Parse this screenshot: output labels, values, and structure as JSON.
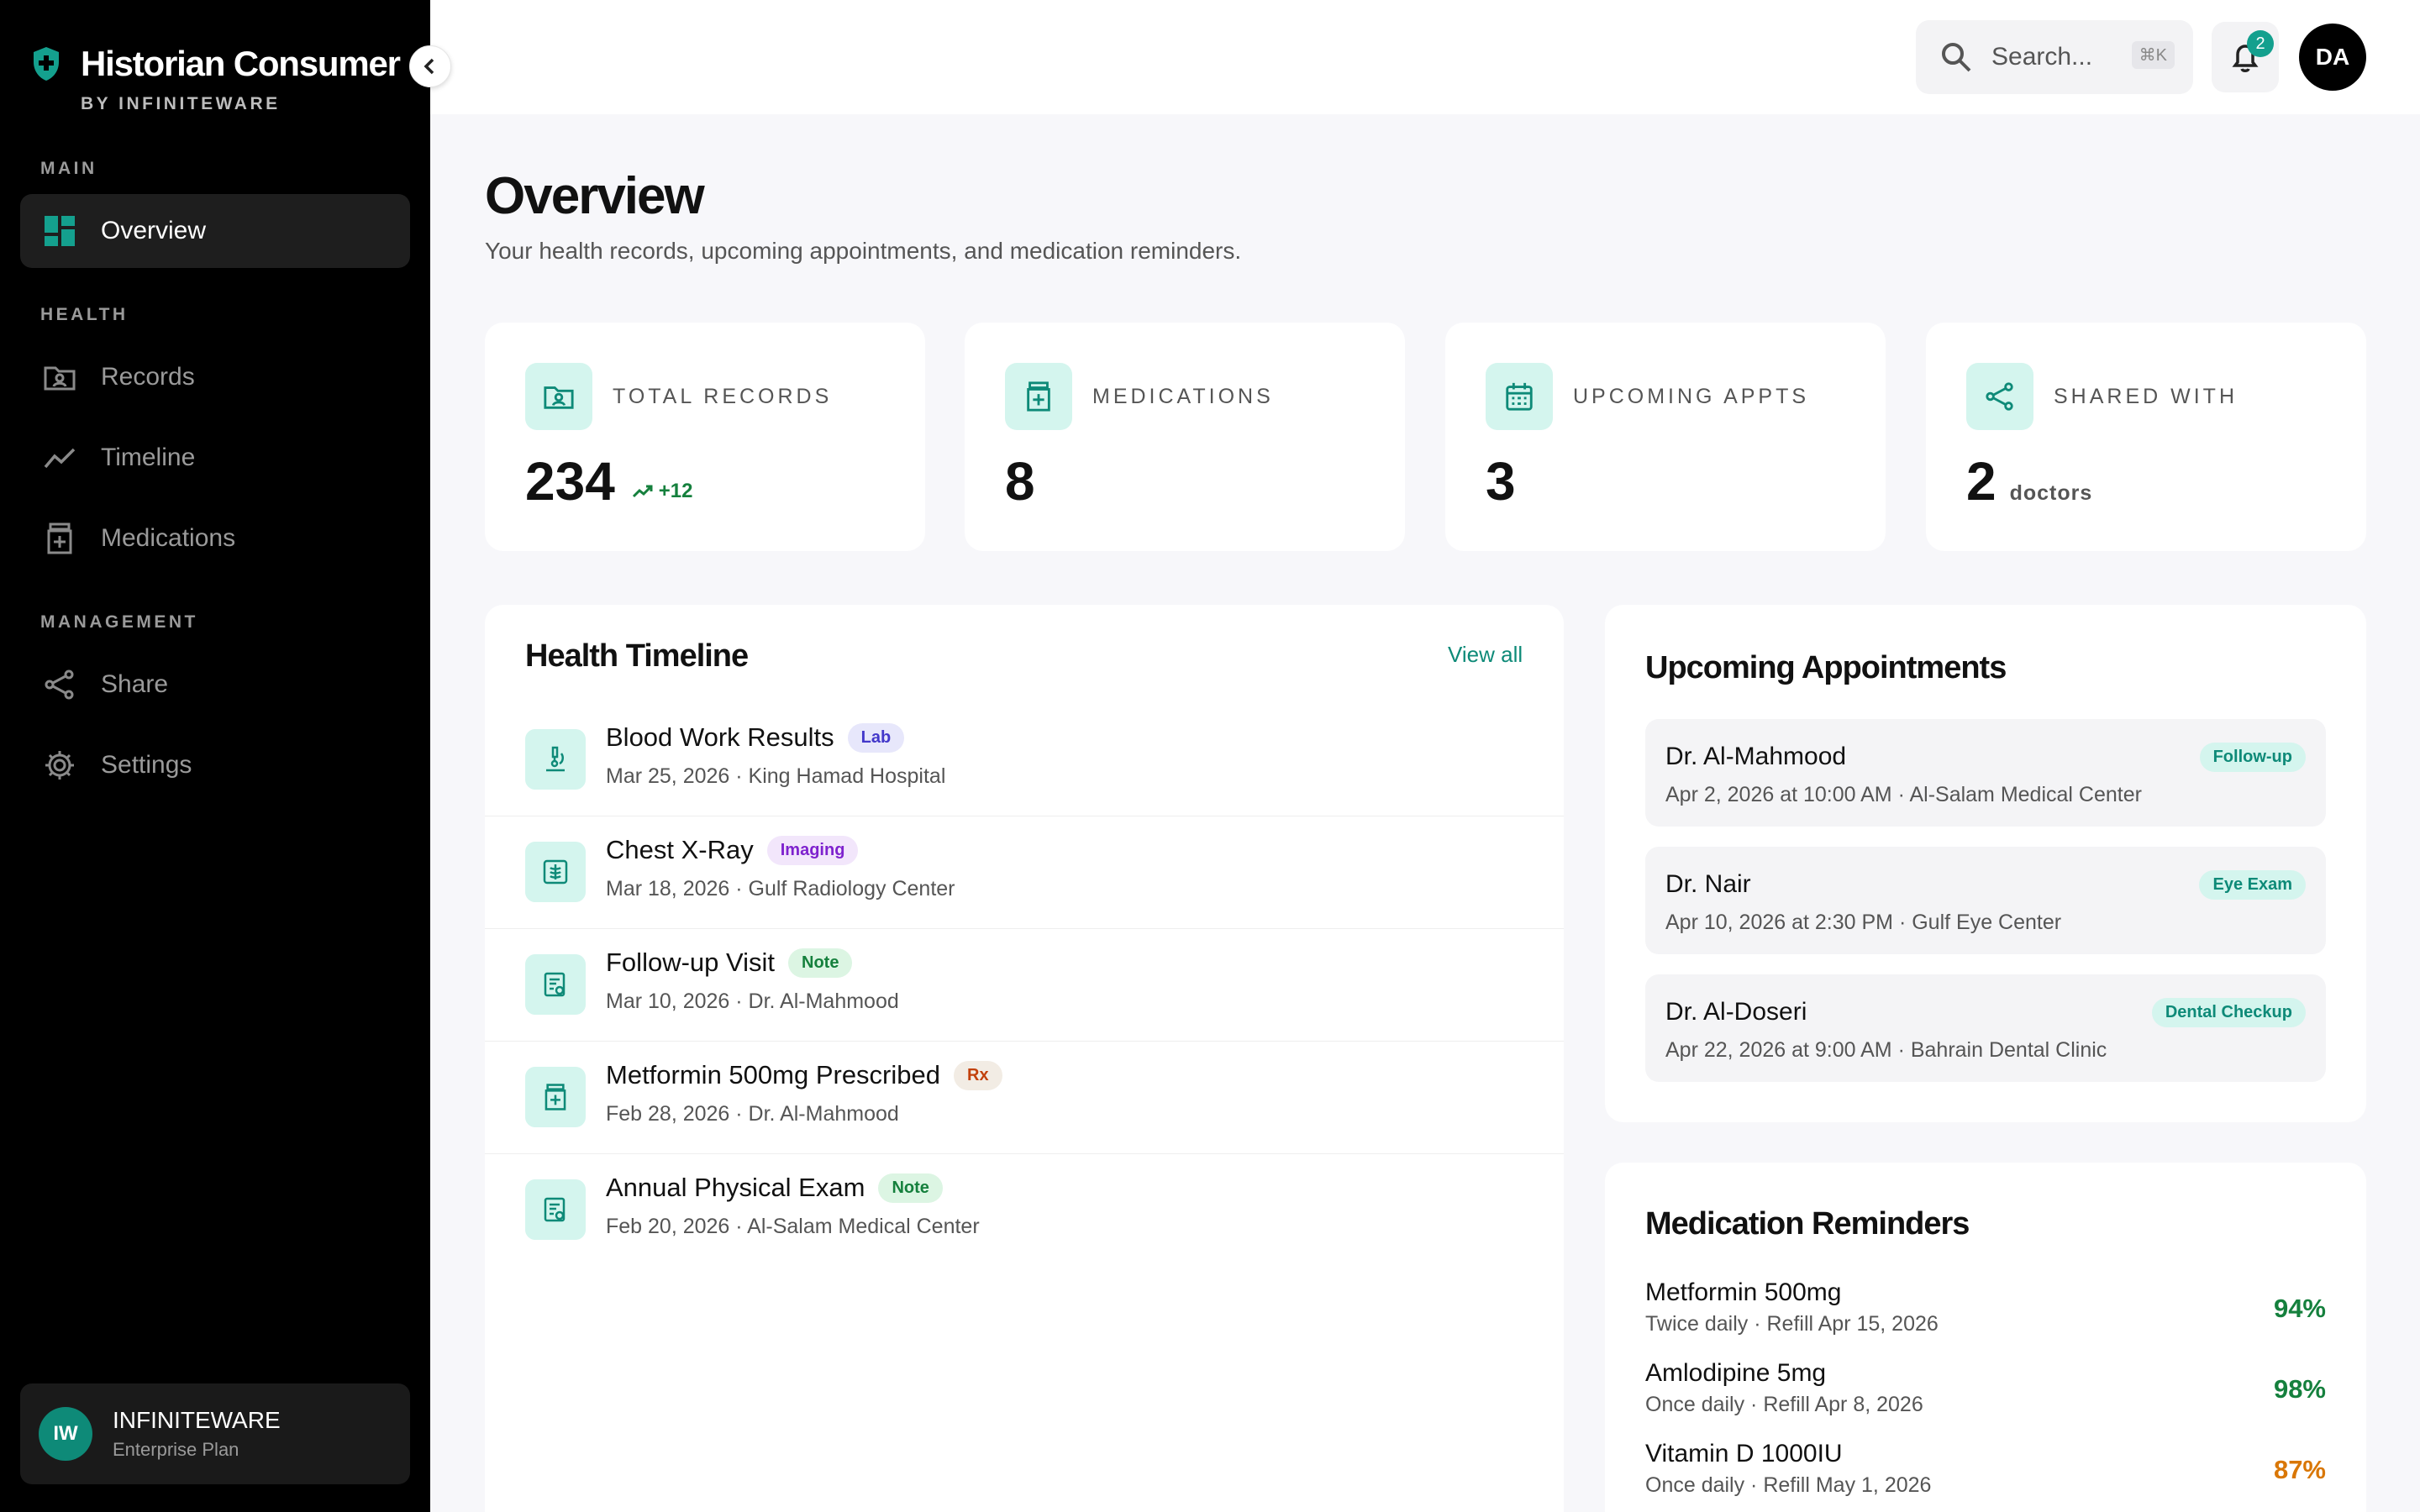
{
  "brand": {
    "title": "Historian Consumer",
    "subtitle": "BY INFINITEWARE"
  },
  "sidebar": {
    "sections": [
      "MAIN",
      "HEALTH",
      "MANAGEMENT"
    ],
    "items": [
      {
        "label": "Overview",
        "icon": "dashboard-icon",
        "active": true
      },
      {
        "label": "Records",
        "icon": "folder-user-icon"
      },
      {
        "label": "Timeline",
        "icon": "trend-line-icon"
      },
      {
        "label": "Medications",
        "icon": "medicine-bottle-icon"
      },
      {
        "label": "Share",
        "icon": "share-icon"
      },
      {
        "label": "Settings",
        "icon": "gear-icon"
      }
    ],
    "org": {
      "initials": "IW",
      "name": "INFINITEWARE",
      "plan": "Enterprise Plan"
    }
  },
  "topbar": {
    "search_placeholder": "Search...",
    "search_shortcut": "⌘K",
    "notification_count": "2",
    "user_initials": "DA"
  },
  "page": {
    "title": "Overview",
    "subtitle": "Your health records, upcoming appointments, and medication reminders."
  },
  "stats": [
    {
      "label": "TOTAL RECORDS",
      "value": "234",
      "delta": "+12",
      "icon": "folder-user-icon"
    },
    {
      "label": "MEDICATIONS",
      "value": "8",
      "icon": "medicine-bottle-icon"
    },
    {
      "label": "UPCOMING APPTS",
      "value": "3",
      "icon": "calendar-icon"
    },
    {
      "label": "SHARED WITH",
      "value": "2",
      "unit": "doctors",
      "icon": "share-icon"
    }
  ],
  "timeline": {
    "title": "Health Timeline",
    "view_all": "View all",
    "items": [
      {
        "title": "Blood Work Results",
        "tag": "Lab",
        "meta": "Mar 25, 2026 · King Hamad Hospital",
        "icon": "microscope-icon"
      },
      {
        "title": "Chest X-Ray",
        "tag": "Imaging",
        "meta": "Mar 18, 2026 · Gulf Radiology Center",
        "icon": "xray-icon"
      },
      {
        "title": "Follow-up Visit",
        "tag": "Note",
        "meta": "Mar 10, 2026 · Dr. Al-Mahmood",
        "icon": "clipboard-note-icon"
      },
      {
        "title": "Metformin 500mg Prescribed",
        "tag": "Rx",
        "meta": "Feb 28, 2026 · Dr. Al-Mahmood",
        "icon": "medicine-bottle-icon"
      },
      {
        "title": "Annual Physical Exam",
        "tag": "Note",
        "meta": "Feb 20, 2026 · Al-Salam Medical Center",
        "icon": "clipboard-note-icon"
      }
    ]
  },
  "appointments": {
    "title": "Upcoming Appointments",
    "items": [
      {
        "doctor": "Dr. Al-Mahmood",
        "tag": "Follow-up",
        "meta": "Apr 2, 2026 at 10:00 AM · Al-Salam Medical Center"
      },
      {
        "doctor": "Dr. Nair",
        "tag": "Eye Exam",
        "meta": "Apr 10, 2026 at 2:30 PM · Gulf Eye Center"
      },
      {
        "doctor": "Dr. Al-Doseri",
        "tag": "Dental Checkup",
        "meta": "Apr 22, 2026 at 9:00 AM · Bahrain Dental Clinic"
      }
    ]
  },
  "medications": {
    "title": "Medication Reminders",
    "items": [
      {
        "name": "Metformin 500mg",
        "meta": "Twice daily · Refill Apr 15, 2026",
        "adherence": "94%",
        "color": "#15803d"
      },
      {
        "name": "Amlodipine 5mg",
        "meta": "Once daily · Refill Apr 8, 2026",
        "adherence": "98%",
        "color": "#15803d"
      },
      {
        "name": "Vitamin D 1000IU",
        "meta": "Once daily · Refill May 1, 2026",
        "adherence": "87%",
        "color": "#d97706"
      }
    ]
  },
  "colors": {
    "accent": "#0e8a78",
    "accent_light": "#d4f5ee",
    "tag_lab": "#4338ca",
    "tag_imaging": "#7e22ce",
    "tag_note": "#15803d",
    "tag_rx": "#c2410c"
  }
}
